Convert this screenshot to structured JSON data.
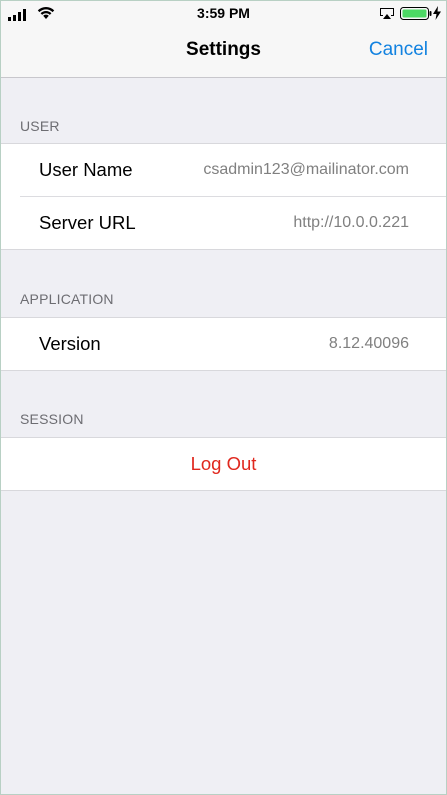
{
  "status_bar": {
    "time": "3:59 PM"
  },
  "nav": {
    "title": "Settings",
    "cancel_label": "Cancel"
  },
  "sections": {
    "user": {
      "header": "USER",
      "rows": [
        {
          "label": "User Name",
          "value": "csadmin123@mailinator.com"
        },
        {
          "label": "Server URL",
          "value": "http://10.0.0.221"
        }
      ]
    },
    "application": {
      "header": "APPLICATION",
      "rows": [
        {
          "label": "Version",
          "value": "8.12.40096"
        }
      ]
    },
    "session": {
      "header": "SESSION",
      "logout_label": "Log Out"
    }
  },
  "colors": {
    "accent": "#1282e0",
    "destructive": "#e0281e",
    "background": "#efeff4",
    "battery": "#4cd964"
  },
  "icons": [
    "signal-icon",
    "wifi-icon",
    "airplay-icon",
    "battery-icon",
    "charging-bolt-icon"
  ]
}
